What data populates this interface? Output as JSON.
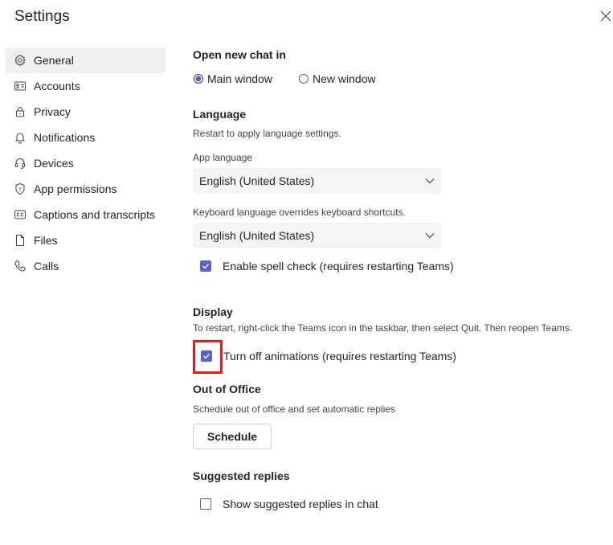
{
  "window": {
    "title": "Settings",
    "close_icon": "close-icon"
  },
  "sidebar": {
    "items": [
      {
        "label": "General",
        "icon": "gear-icon",
        "active": true
      },
      {
        "label": "Accounts",
        "icon": "id-card-icon"
      },
      {
        "label": "Privacy",
        "icon": "lock-icon"
      },
      {
        "label": "Notifications",
        "icon": "bell-icon"
      },
      {
        "label": "Devices",
        "icon": "headset-icon"
      },
      {
        "label": "App permissions",
        "icon": "shield-icon"
      },
      {
        "label": "Captions and transcripts",
        "icon": "cc-icon"
      },
      {
        "label": "Files",
        "icon": "file-icon"
      },
      {
        "label": "Calls",
        "icon": "phone-icon"
      }
    ]
  },
  "open_chat": {
    "heading": "Open new chat in",
    "options": [
      {
        "label": "Main window",
        "selected": true
      },
      {
        "label": "New window",
        "selected": false
      }
    ]
  },
  "language": {
    "heading": "Language",
    "note": "Restart to apply language settings.",
    "app_language_label": "App language",
    "app_language_value": "English (United States)",
    "keyboard_label": "Keyboard language overrides keyboard shortcuts.",
    "keyboard_value": "English (United States)",
    "spell_check_label": "Enable spell check (requires restarting Teams)",
    "spell_check_checked": true
  },
  "display": {
    "heading": "Display",
    "note": "To restart, right-click the Teams icon in the taskbar, then select Quit. Then reopen Teams.",
    "animations_label": "Turn off animations (requires restarting Teams)",
    "animations_checked": true
  },
  "out_of_office": {
    "heading": "Out of Office",
    "note": "Schedule out of office and set automatic replies",
    "button_label": "Schedule"
  },
  "suggested_replies": {
    "heading": "Suggested replies",
    "label": "Show suggested replies in chat",
    "checked": false
  },
  "colors": {
    "accent": "#5b5fc7",
    "highlight": "#e11c1c",
    "active_nav_bg": "#f0f0f0"
  }
}
